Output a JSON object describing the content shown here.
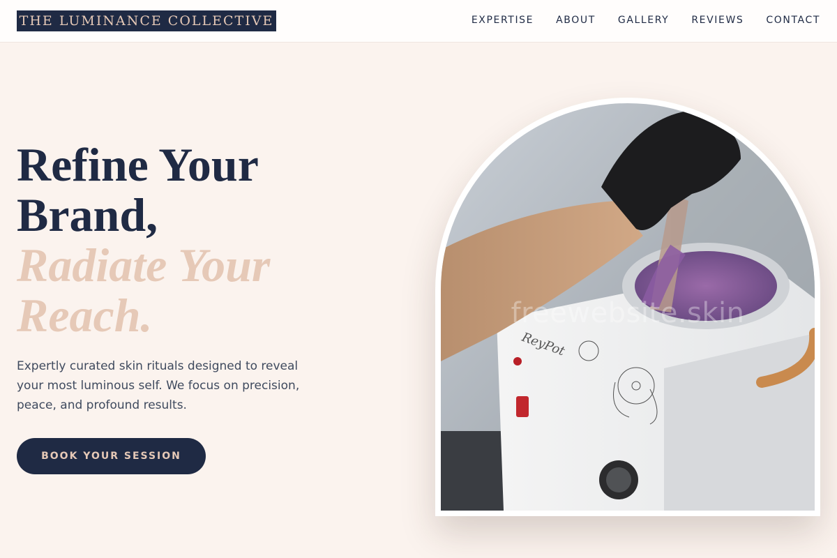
{
  "header": {
    "logo": "THE LUMINANCE COLLECTIVE",
    "nav": [
      "EXPERTISE",
      "ABOUT",
      "GALLERY",
      "REVIEWS",
      "CONTACT"
    ]
  },
  "hero": {
    "title_lines": [
      "Refine Your",
      "Brand,"
    ],
    "accent_lines": [
      "Radiate Your",
      "Reach."
    ],
    "description": "Expertly curated skin rituals designed to reveal your most luminous self. We focus on precision, peace, and profound results.",
    "cta_label": "BOOK YOUR SESSION"
  },
  "image": {
    "watermark": "freewebsite.skin",
    "device_brand": "ReyPot"
  },
  "colors": {
    "navy": "#1f2a44",
    "blush": "#e6c9b7",
    "background": "#fbf3ee"
  }
}
